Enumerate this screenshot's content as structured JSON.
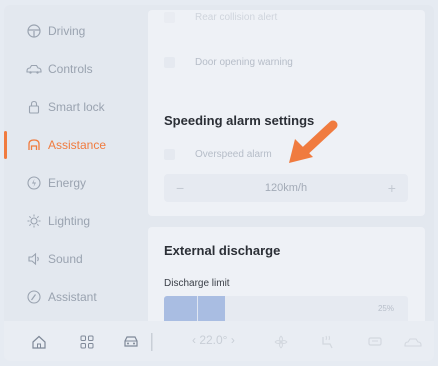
{
  "sidebar": {
    "items": [
      {
        "label": "Driving",
        "icon": "steering-wheel-icon"
      },
      {
        "label": "Controls",
        "icon": "car-icon"
      },
      {
        "label": "Smart lock",
        "icon": "lock-icon"
      },
      {
        "label": "Assistance",
        "icon": "assistance-icon",
        "active": true
      },
      {
        "label": "Energy",
        "icon": "energy-icon"
      },
      {
        "label": "Lighting",
        "icon": "light-icon"
      },
      {
        "label": "Sound",
        "icon": "speaker-icon"
      },
      {
        "label": "Assistant",
        "icon": "gauge-icon"
      }
    ]
  },
  "content": {
    "partial_row_label": "Rear collision alert",
    "door_warning_label": "Door opening warning",
    "speeding_title": "Speeding alarm settings",
    "overspeed_label": "Overspeed alarm",
    "speed_value": "120km/h",
    "minus": "−",
    "plus": "+",
    "discharge_title": "External discharge",
    "discharge_limit_label": "Discharge limit",
    "discharge_percent": "25%",
    "discharge_fraction": 0.25
  },
  "bottom": {
    "temp": "‹  22.0°  ›"
  },
  "colors": {
    "accent": "#f07b3f",
    "bar_fill": "#a9bde2"
  }
}
